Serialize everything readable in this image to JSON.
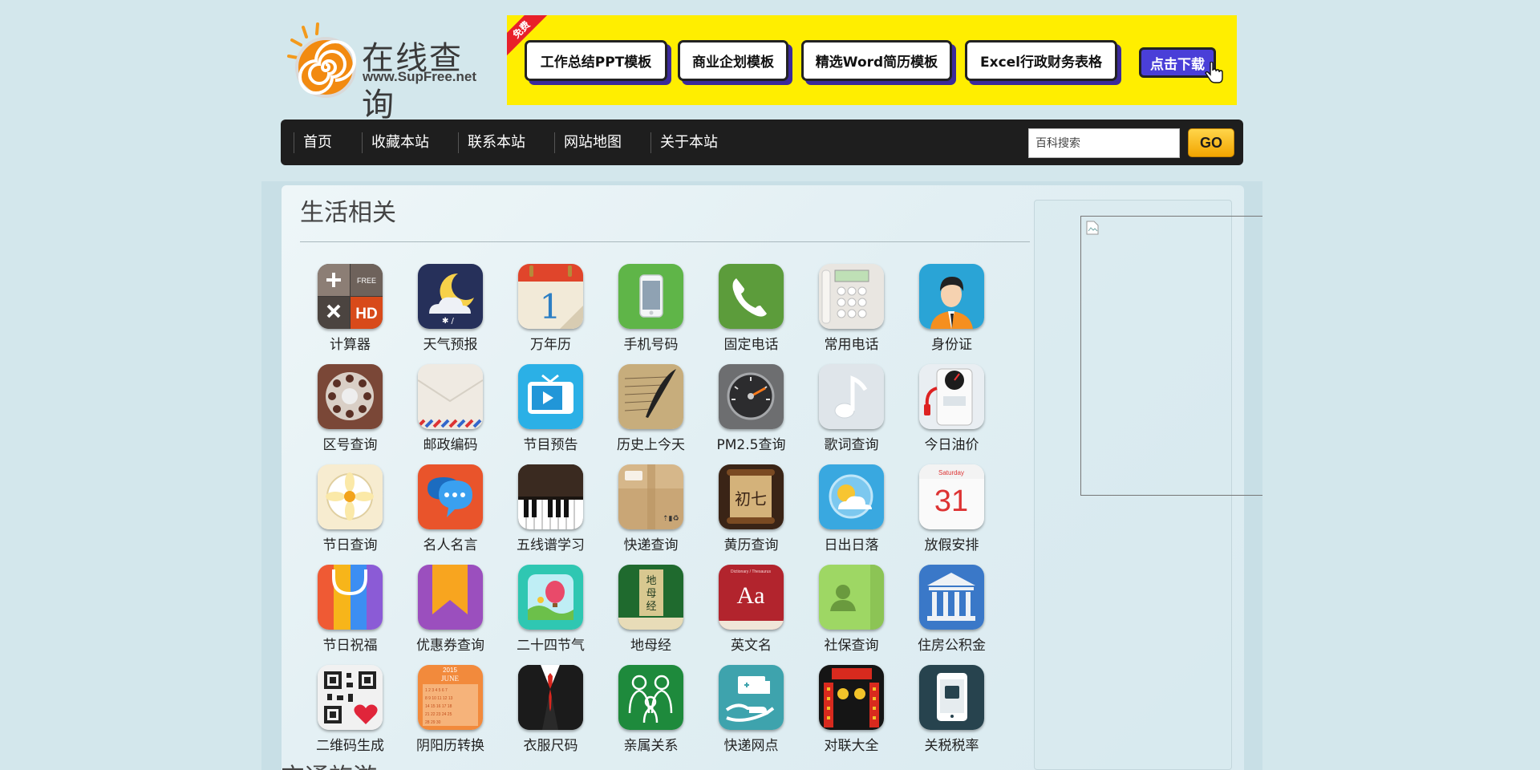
{
  "logo": {
    "title": "在线查询",
    "url": "www.SupFree.net"
  },
  "banner": {
    "ribbon": "免费",
    "buttons": [
      "工作总结PPT模板",
      "商业企划模板",
      "精选Word简历模板",
      "Excel行政财务表格"
    ],
    "download": "点击下载"
  },
  "nav": {
    "items": [
      "首页",
      "收藏本站",
      "联系本站",
      "网站地图",
      "关于本站"
    ],
    "search_placeholder": "百科搜索",
    "go_label": "GO"
  },
  "section": {
    "title": "生活相关",
    "next_title": "交通旅游"
  },
  "apps": [
    {
      "label": "计算器",
      "icon": "calculator-icon"
    },
    {
      "label": "天气预报",
      "icon": "weather-icon"
    },
    {
      "label": "万年历",
      "icon": "calendar-icon"
    },
    {
      "label": "手机号码",
      "icon": "mobile-phone-icon"
    },
    {
      "label": "固定电话",
      "icon": "telephone-icon"
    },
    {
      "label": "常用电话",
      "icon": "desk-phone-icon"
    },
    {
      "label": "身份证",
      "icon": "id-person-icon"
    },
    {
      "label": "区号查询",
      "icon": "rotary-dial-icon"
    },
    {
      "label": "邮政编码",
      "icon": "envelope-icon"
    },
    {
      "label": "节目预告",
      "icon": "tv-icon"
    },
    {
      "label": "历史上今天",
      "icon": "quill-icon"
    },
    {
      "label": "PM2.5查询",
      "icon": "gauge-icon"
    },
    {
      "label": "歌词查询",
      "icon": "music-note-icon"
    },
    {
      "label": "今日油价",
      "icon": "fuel-pump-icon"
    },
    {
      "label": "节日查询",
      "icon": "flower-icon"
    },
    {
      "label": "名人名言",
      "icon": "chat-bubble-icon"
    },
    {
      "label": "五线谱学习",
      "icon": "piano-icon"
    },
    {
      "label": "快递查询",
      "icon": "parcel-box-icon"
    },
    {
      "label": "黄历查询",
      "icon": "scroll-icon"
    },
    {
      "label": "日出日落",
      "icon": "sun-cloud-icon"
    },
    {
      "label": "放假安排",
      "icon": "calendar-31-icon"
    },
    {
      "label": "节日祝福",
      "icon": "shopping-bag-icon"
    },
    {
      "label": "优惠券查询",
      "icon": "coupon-ribbon-icon"
    },
    {
      "label": "二十四节气",
      "icon": "balloon-icon"
    },
    {
      "label": "地母经",
      "icon": "book-icon"
    },
    {
      "label": "英文名",
      "icon": "dictionary-icon"
    },
    {
      "label": "社保查询",
      "icon": "contact-card-icon"
    },
    {
      "label": "住房公积金",
      "icon": "bank-building-icon"
    },
    {
      "label": "二维码生成",
      "icon": "qr-code-icon"
    },
    {
      "label": "阴阳历转换",
      "icon": "lunar-calendar-icon"
    },
    {
      "label": "衣服尺码",
      "icon": "suit-icon"
    },
    {
      "label": "亲属关系",
      "icon": "family-icon"
    },
    {
      "label": "快递网点",
      "icon": "delivery-hand-icon"
    },
    {
      "label": "对联大全",
      "icon": "couplet-icon"
    },
    {
      "label": "关税税率",
      "icon": "tax-tablet-icon"
    }
  ],
  "icon_text": {
    "calc_free": "FREE",
    "calc_hd": "HD",
    "cal_day": "1",
    "cal31_head": "Saturday",
    "cal31_day": "31",
    "dict_head": "Dictionary / Thesaurus",
    "dict_aa": "Aa",
    "book_text": "地母经",
    "lunar_year": "2015",
    "lunar_month": "JUNE",
    "scroll_text": "初七"
  }
}
